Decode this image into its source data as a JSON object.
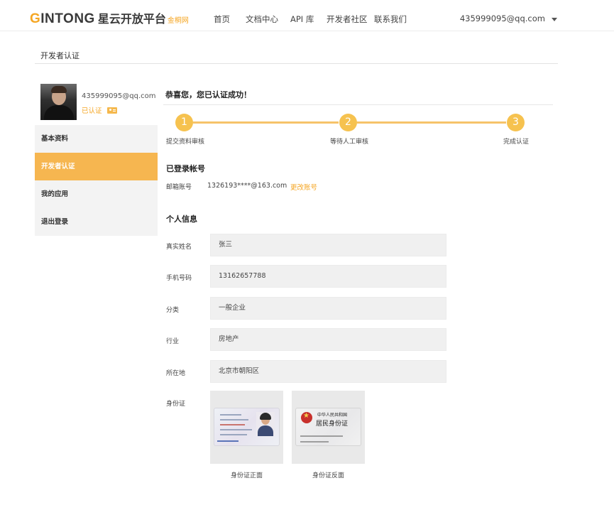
{
  "header": {
    "logo_g": "G",
    "logo_text": "INTONG",
    "logo_cn": "星云开放平台",
    "logo_sub": "金桐网",
    "nav": [
      "首页",
      "文档中心",
      "API 库",
      "开发者社区",
      "联系我们"
    ],
    "user_email": "435999095@qq.com"
  },
  "page": {
    "title": "开发者认证"
  },
  "sidebar": {
    "email": "435999095@qq.com",
    "status": "已认证",
    "menu": [
      {
        "label": "基本资料",
        "active": false
      },
      {
        "label": "开发者认证",
        "active": true
      },
      {
        "label": "我的应用",
        "active": false
      },
      {
        "label": "退出登录",
        "active": false
      }
    ]
  },
  "content": {
    "success_message": "恭喜您，您已认证成功！",
    "steps": [
      {
        "num": "1",
        "label": "提交资料审核"
      },
      {
        "num": "2",
        "label": "等待人工审核"
      },
      {
        "num": "3",
        "label": "完成认证"
      }
    ],
    "account_section": "已登录帐号",
    "account_label": "邮箱账号",
    "account_value": "1326193****@163.com",
    "account_change": "更改账号",
    "personal_section": "个人信息",
    "fields": [
      {
        "label": "真实姓名",
        "value": "张三"
      },
      {
        "label": "手机号码",
        "value": "13162657788"
      },
      {
        "label": "分类",
        "value": "一般企业"
      },
      {
        "label": "行业",
        "value": "房地产"
      },
      {
        "label": "所在地",
        "value": "北京市朝阳区"
      }
    ],
    "id_label": "身份证",
    "id_front_caption": "身份证正面",
    "id_back_caption": "身份证反面",
    "id_back_title1": "中华人民共和国",
    "id_back_title2": "居民身份证"
  },
  "colors": {
    "accent": "#f6b650",
    "accent_text": "#f5a623",
    "step_circle": "#f6c24f"
  }
}
